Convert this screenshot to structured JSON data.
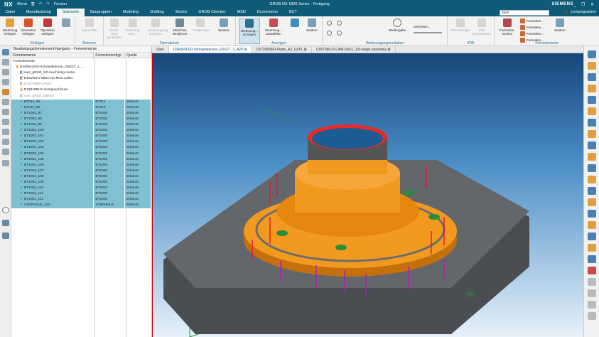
{
  "app": {
    "logo": "NX",
    "menu_label": "Menü",
    "window_title": "GROB NX 1926 Series - Fertigung",
    "brand": "SIEMENS",
    "window_label": "Fenster",
    "window_controls": "_ ❐ ✕"
  },
  "tabs": [
    {
      "label": "Datei",
      "active": false
    },
    {
      "label": "Manufacturing",
      "active": false
    },
    {
      "label": "Startseite",
      "active": true
    },
    {
      "label": "Baugruppen",
      "active": false
    },
    {
      "label": "Modeling",
      "active": false
    },
    {
      "label": "Drafting",
      "active": false
    },
    {
      "label": "Sketch",
      "active": false
    },
    {
      "label": "GROB Checker",
      "active": false
    },
    {
      "label": "MSD",
      "active": false
    },
    {
      "label": "Dconnexion",
      "active": false
    },
    {
      "label": "BCT",
      "active": false
    }
  ],
  "search": {
    "value": "layer"
  },
  "learn_label": "Lernprogramme",
  "ribbon": {
    "einfuegen": {
      "label": "Einfügen",
      "buttons": [
        "Werkzeug einlegen",
        "Geometrie einlegen",
        "Operation einlegen"
      ]
    },
    "aktionen": {
      "label": "Aktionen",
      "buttons": [
        "Eigenscha..."
      ]
    },
    "operationen": {
      "label": "Operationen",
      "buttons": [
        "Werkz. Weg generieren",
        "Werkzeug-weg ...",
        "Werkzeugweg anzeigen",
        "Maschine simulieren",
        "Postprocess",
        "Weitere"
      ]
    },
    "anzeigen": {
      "label": "Anzeigen",
      "buttons": [
        "Werkzeug... anzeigen",
        "Werkzeug... auswählen",
        "Weitere"
      ]
    },
    "werkzeugwegemulation": {
      "label": "Werkzeugwegemulation",
      "buttons": [
        "Wiedergabe",
        "Geschwin..."
      ]
    },
    "ipw": {
      "label": "IPW",
      "buttons": [
        "IPW anzeigen",
        "IPW zurücksetzen"
      ]
    },
    "formelemente": {
      "label": "Formelemente",
      "buttons": [
        "Formelem. suchen",
        "Formelem...",
        "Formelem...",
        "Formelem...",
        "Formelem...",
        "Weitere"
      ]
    }
  },
  "navigator": {
    "title": "Bearbeitungsformelement-Navigator - Formelemente",
    "columns": [
      "Formelemente",
      "Formelementtyp",
      "Quelle"
    ],
    "root_label": "Formelemente",
    "tree": [
      {
        "label": "D3405416/D-Schraenkkrone_G5S2T_1_...",
        "type": "",
        "source": "",
        "sel": false
      },
      {
        "label": "cam_g5S2t_1/0-machining centre",
        "type": "",
        "source": "",
        "sel": false
      },
      {
        "label": "D1619574-S864T10-RNC-pallet",
        "type": "",
        "source": "",
        "sel": false
      },
      {
        "label": "D3373666-CAM/0",
        "type": "",
        "source": "",
        "sel": false
      },
      {
        "label": "D3181991/0-clamping fixture",
        "type": "",
        "source": "",
        "sel": false
      },
      {
        "label": "cam_g5S2t_pallet/0",
        "type": "",
        "source": "",
        "sel": false
      }
    ],
    "features": [
      {
        "label": "BT012_95",
        "type": "BT012",
        "source": "Erkannt"
      },
      {
        "label": "BT012_96",
        "type": "BT012",
        "source": "Erkannt"
      },
      {
        "label": "BT1003_97",
        "type": "BT1003",
        "source": "Erkannt"
      },
      {
        "label": "BT1003_98",
        "type": "BT1003",
        "source": "Erkannt"
      },
      {
        "label": "BT1003_99",
        "type": "BT1003",
        "source": "Erkannt"
      },
      {
        "label": "BT1003_100",
        "type": "BT1003",
        "source": "Erkannt"
      },
      {
        "label": "BT1003_101",
        "type": "BT1003",
        "source": "Erkannt"
      },
      {
        "label": "BT1003_102",
        "type": "BT1003",
        "source": "Erkannt"
      },
      {
        "label": "BT1003_103",
        "type": "BT1003",
        "source": "Erkannt"
      },
      {
        "label": "BT1003_104",
        "type": "BT1003",
        "source": "Erkannt"
      },
      {
        "label": "BT1003_105",
        "type": "BT1003",
        "source": "Erkannt"
      },
      {
        "label": "BT1003_106",
        "type": "BT1003",
        "source": "Erkannt"
      },
      {
        "label": "BT1003_107",
        "type": "BT1003",
        "source": "Erkannt"
      },
      {
        "label": "BT1003_108",
        "type": "BT1003",
        "source": "Erkannt"
      },
      {
        "label": "BT1003_109",
        "type": "BT1003",
        "source": "Erkannt"
      },
      {
        "label": "BT1003_110",
        "type": "BT1003",
        "source": "Erkannt"
      },
      {
        "label": "BT1003_111",
        "type": "BT1003",
        "source": "Erkannt"
      },
      {
        "label": "BT1003_112",
        "type": "BT1003",
        "source": "Erkannt"
      },
      {
        "label": "STEPHOLE_113",
        "type": "STEPHOLE",
        "source": "Erkannt"
      }
    ]
  },
  "doc_tabs": [
    {
      "label": "Start",
      "active": false
    },
    {
      "label": "D3405416/0-Schraenkkrone_G5S2T_1_A20 ⊠",
      "active": true
    },
    {
      "label": "D3739688/0-Platte_A2_G551 ⊠",
      "active": false
    },
    {
      "label": "C897588 /0-CAM-G551_1/0-target assembly ⊠",
      "active": false
    }
  ],
  "viewport": {
    "pallet_label": "B0"
  },
  "colors": {
    "titlebar": "#0e5a77",
    "selected_row": "#7fc0d3",
    "part_orange": "#f29a1f",
    "top_ring": "#e52a2a",
    "pallet": "#5a5e62",
    "vector_red": "#e0143c",
    "vector_magenta": "#b01fb5"
  }
}
